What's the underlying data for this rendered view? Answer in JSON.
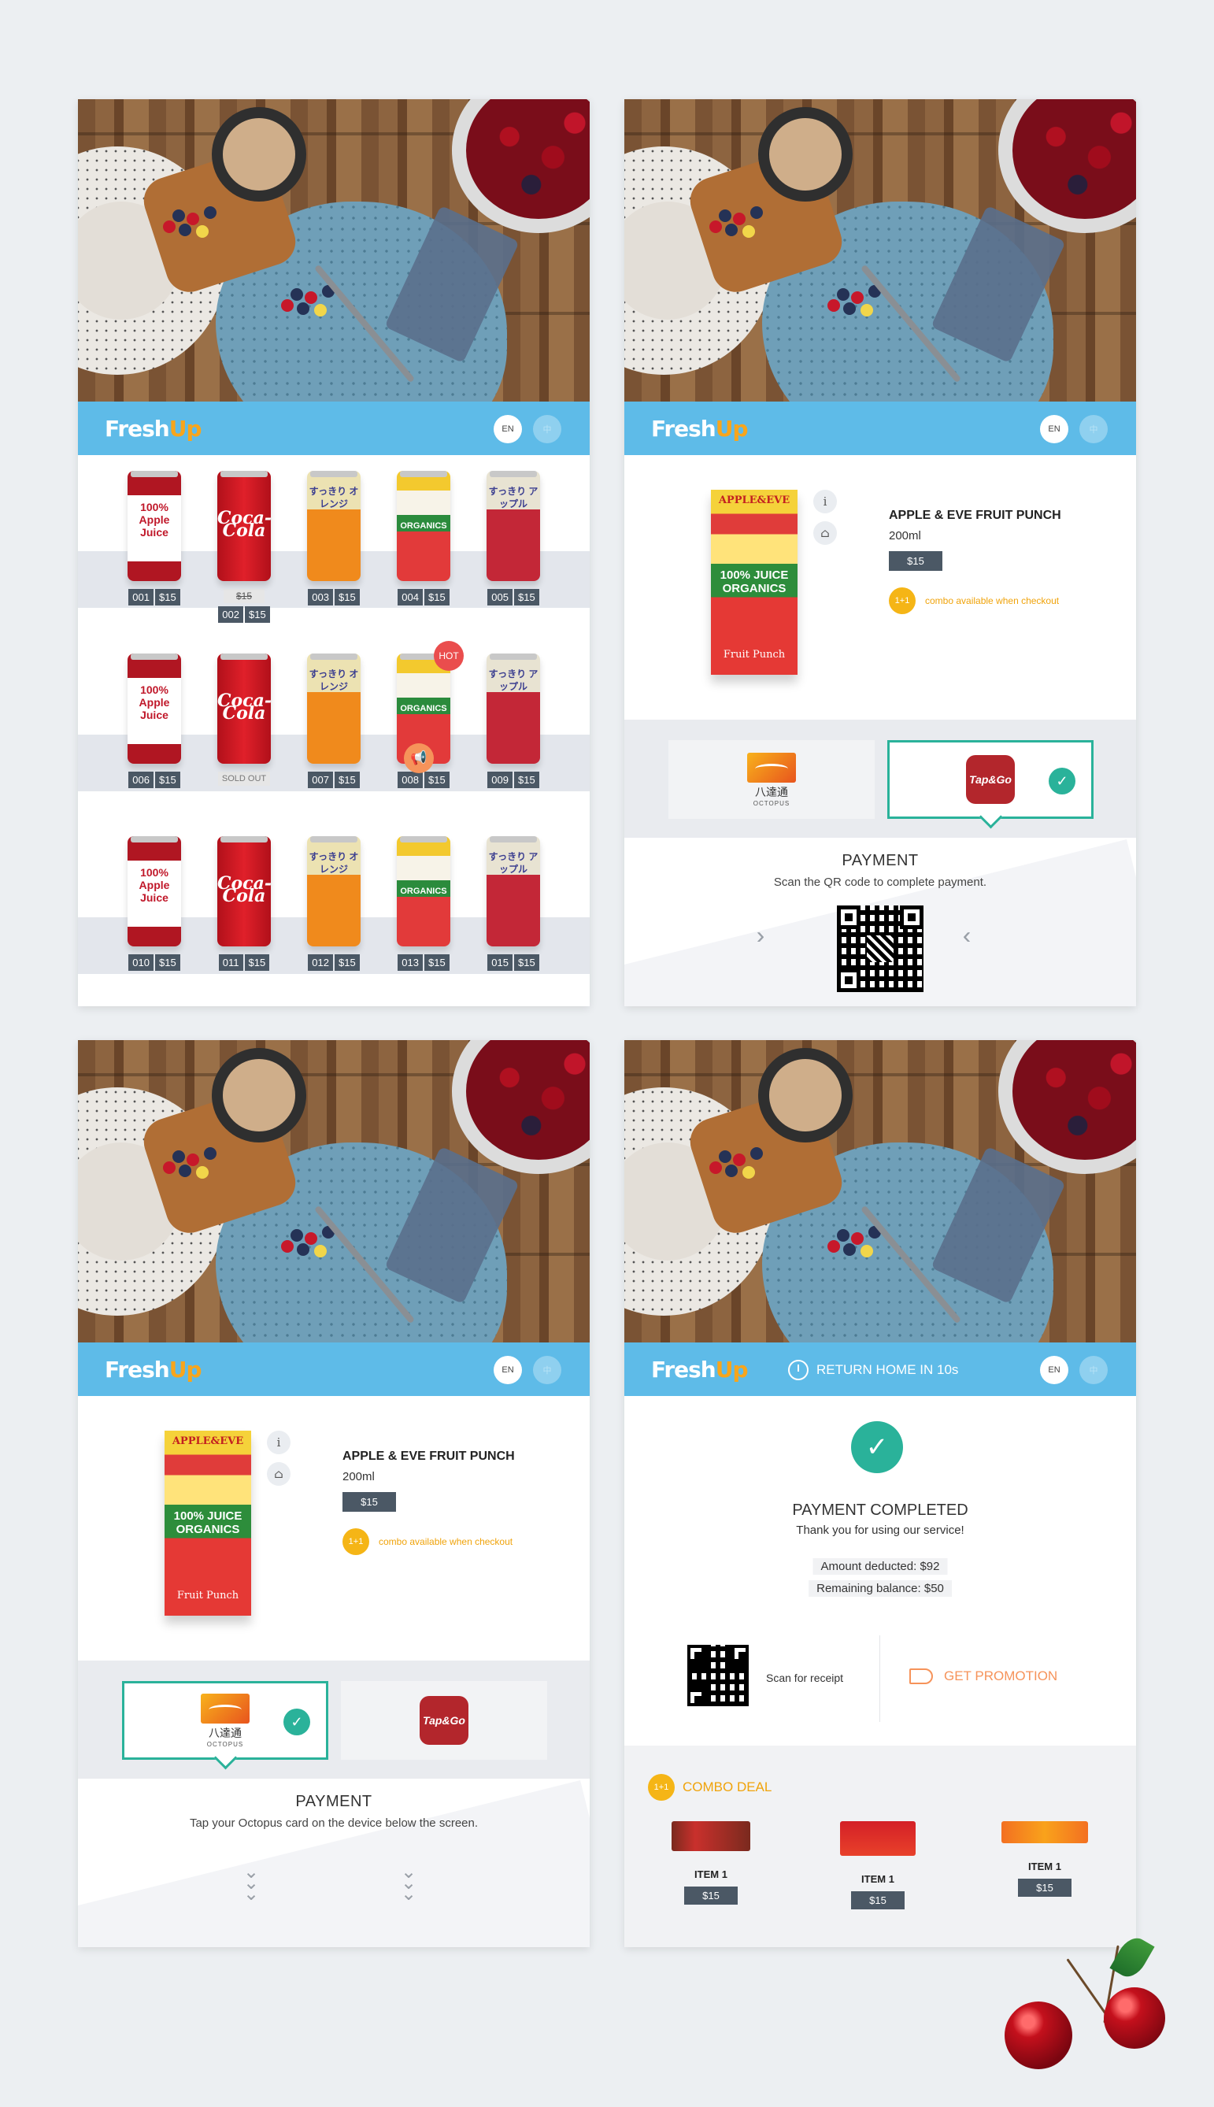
{
  "brand": {
    "logo_fresh": "Fresh",
    "logo_up": "Up"
  },
  "langs": {
    "en": "EN",
    "tc": "中"
  },
  "grid": {
    "rows": [
      [
        {
          "type": "apple",
          "label": "100% Apple Juice",
          "code": "001",
          "price": "$15",
          "badge": "promo"
        },
        {
          "type": "coke",
          "label": "Coca-Cola",
          "code": "002",
          "price": "$15",
          "old_price": "$15"
        },
        {
          "type": "orange",
          "label": "すっきり オレンジ",
          "code": "003",
          "price": "$15"
        },
        {
          "type": "punch",
          "label": "ORGANICS",
          "code": "004",
          "price": "$15"
        },
        {
          "type": "apple2",
          "label": "すっきり アップル",
          "code": "005",
          "price": "$15"
        }
      ],
      [
        {
          "type": "apple",
          "label": "100% Apple Juice",
          "code": "006",
          "price": "$15"
        },
        {
          "type": "coke",
          "label": "Coca-Cola",
          "sold_out": "SOLD OUT"
        },
        {
          "type": "orange",
          "label": "すっきり オレンジ",
          "code": "007",
          "price": "$15"
        },
        {
          "type": "punch",
          "label": "ORGANICS",
          "code": "008",
          "price": "$15",
          "badge": "hot",
          "badge_text": "HOT"
        },
        {
          "type": "apple2",
          "label": "すっきり アップル",
          "code": "009",
          "price": "$15"
        }
      ],
      [
        {
          "type": "apple",
          "label": "100% Apple Juice",
          "code": "010",
          "price": "$15"
        },
        {
          "type": "coke",
          "label": "Coca-Cola",
          "code": "011",
          "price": "$15"
        },
        {
          "type": "orange",
          "label": "すっきり オレンジ",
          "code": "012",
          "price": "$15"
        },
        {
          "type": "punch",
          "label": "ORGANICS",
          "code": "013",
          "price": "$15"
        },
        {
          "type": "apple2",
          "label": "すっきり アップル",
          "code": "015",
          "price": "$15"
        }
      ]
    ]
  },
  "product": {
    "name": "APPLE & EVE FRUIT PUNCH",
    "size": "200ml",
    "price": "$15",
    "combo_badge": "1+1",
    "combo_text": "combo available when checkout",
    "carton_brand": "APPLE&EVE",
    "carton_line": "100% JUICE ORGANICS",
    "carton_name": "Fruit Punch",
    "info_icon": "i"
  },
  "methods": {
    "octopus_cn": "八達通",
    "octopus_en": "OCTOPUS",
    "tapgo": "Tap&Go"
  },
  "payment_qr": {
    "title": "PAYMENT",
    "subtitle": "Scan the QR code to complete payment."
  },
  "payment_octopus": {
    "title": "PAYMENT",
    "subtitle": "Tap your Octopus card on the device below the screen."
  },
  "complete": {
    "countdown": "RETURN HOME IN 10s",
    "title": "PAYMENT COMPLETED",
    "subtitle": "Thank you for using our service!",
    "amount": "Amount deducted: $92",
    "balance": "Remaining balance: $50",
    "receipt": "Scan for receipt",
    "promotion": "GET PROMOTION"
  },
  "combo_deal": {
    "badge": "1+1",
    "title": "COMBO DEAL",
    "items": [
      {
        "name": "ITEM 1",
        "price": "$15",
        "candy": "KitKat"
      },
      {
        "name": "ITEM 1",
        "price": "$15",
        "candy": "m&m's"
      },
      {
        "name": "ITEM 1",
        "price": "$15",
        "candy": "Reese's"
      }
    ]
  },
  "colors": {
    "header": "#5ebbe8",
    "accent": "#2ab29a",
    "orange": "#f5b516",
    "price_tag": "#4b5865"
  }
}
